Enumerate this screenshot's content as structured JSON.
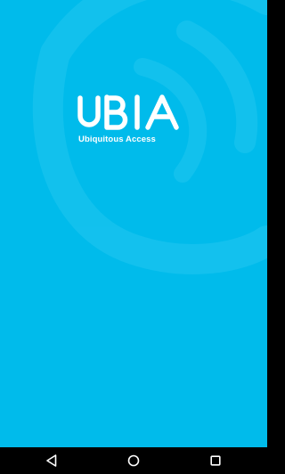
{
  "colors": {
    "background": "#00bbeb",
    "watermark": "#22c7f0",
    "logo": "#ffffff",
    "navbar": "#000000",
    "nav_icons": "#ffffff"
  },
  "logo": {
    "wordmark": "UBIA",
    "tagline": "Ubiquitous Access"
  },
  "navigation_bar": {
    "buttons": [
      {
        "name": "back",
        "icon": "triangle-back-icon"
      },
      {
        "name": "home",
        "icon": "circle-home-icon"
      },
      {
        "name": "recents",
        "icon": "square-recents-icon"
      }
    ]
  }
}
